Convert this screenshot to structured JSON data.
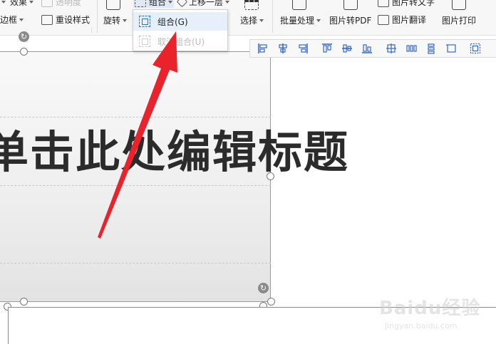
{
  "ribbon": {
    "effects_label": "效果",
    "transparency_label": "透明度",
    "border_label": "边框",
    "reset_style_label": "重设样式",
    "rotate_label": "旋转",
    "group_label": "组合",
    "bring_forward_label": "上移一层",
    "select_label": "选择",
    "batch_label": "批量处理",
    "to_pdf_label": "图片转PDF",
    "to_text_label": "图片转文字",
    "translate_label": "图片翻译",
    "print_label": "图片打印"
  },
  "dropdown": {
    "group_item": "组合(G)",
    "ungroup_item": "取消组合(U)"
  },
  "slide": {
    "title_text": "单击此处编辑标题"
  },
  "watermark": {
    "logo": "Baidu经验",
    "url": "jingyan.baidu.com"
  },
  "colors": {
    "accent_blue": "#2f6fd0",
    "arrow_red": "#e8232b",
    "hover_bg": "#e6f0fb"
  }
}
